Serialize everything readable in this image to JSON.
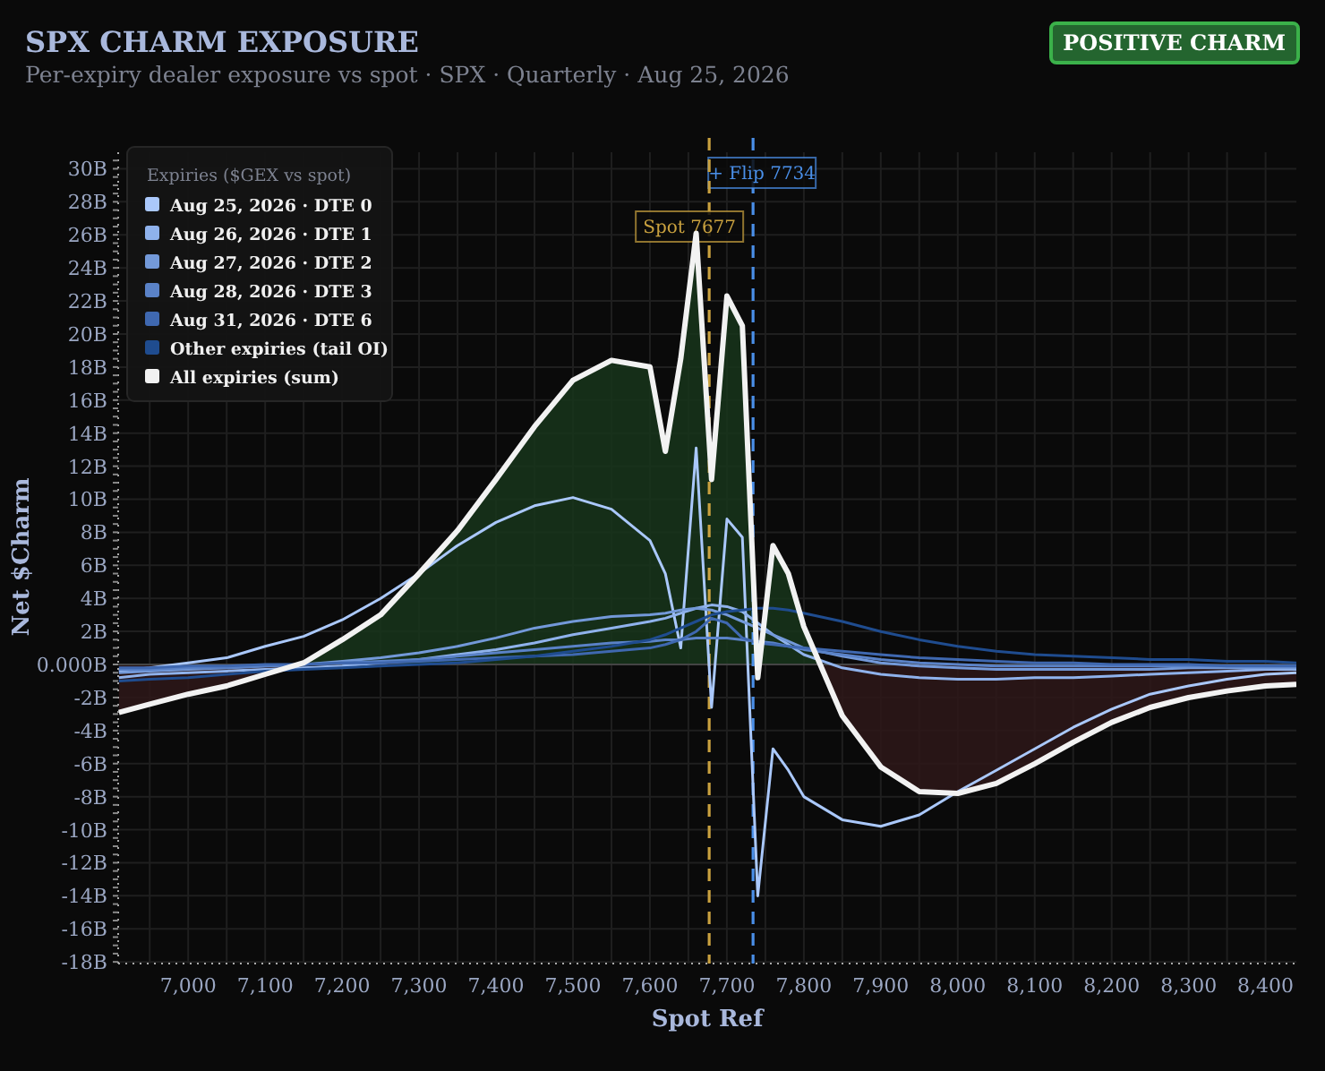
{
  "header": {
    "title": "SPX CHARM EXPOSURE",
    "subtitle": "Per-expiry dealer exposure vs spot · SPX · Quarterly · Aug 25, 2026",
    "badge": {
      "text": "POSITIVE CHARM"
    }
  },
  "chart": {
    "chart_data": {
      "type": "line",
      "xlabel": "Spot Ref",
      "ylabel": "Net $Charm",
      "grid": true,
      "legend": {
        "title": "Expiries ($GEX vs spot)"
      },
      "x": [
        6910,
        6950,
        7000,
        7050,
        7100,
        7150,
        7200,
        7250,
        7300,
        7350,
        7400,
        7450,
        7500,
        7550,
        7600,
        7620,
        7640,
        7660,
        7680,
        7700,
        7720,
        7740,
        7760,
        7780,
        7800,
        7850,
        7900,
        7950,
        8000,
        8050,
        8100,
        8150,
        8200,
        8250,
        8300,
        8350,
        8400,
        8440
      ],
      "series": [
        {
          "name": "Aug 25, 2026 · DTE 0",
          "color": "#aac8fb",
          "values": [
            -0.4,
            -0.2,
            0.1,
            0.4,
            1.1,
            1.7,
            2.7,
            4.0,
            5.5,
            7.2,
            8.6,
            9.6,
            10.1,
            9.4,
            7.5,
            5.5,
            1.0,
            13.1,
            -2.6,
            8.8,
            7.7,
            -14.0,
            -5.1,
            -6.4,
            -8.0,
            -9.4,
            -9.8,
            -9.1,
            -7.7,
            -6.4,
            -5.1,
            -3.8,
            -2.7,
            -1.8,
            -1.3,
            -0.9,
            -0.6,
            -0.5
          ]
        },
        {
          "name": "Aug 26, 2026 · DTE 1",
          "color": "#8fb2ec",
          "values": [
            -0.8,
            -0.6,
            -0.5,
            -0.4,
            -0.3,
            -0.2,
            -0.1,
            0.1,
            0.3,
            0.6,
            0.9,
            1.3,
            1.8,
            2.2,
            2.6,
            2.8,
            3.1,
            3.4,
            3.6,
            3.5,
            3.2,
            2.5,
            1.8,
            1.2,
            0.6,
            -0.2,
            -0.6,
            -0.8,
            -0.9,
            -0.9,
            -0.8,
            -0.8,
            -0.7,
            -0.6,
            -0.5,
            -0.4,
            -0.3,
            -0.3
          ]
        },
        {
          "name": "Aug 27, 2026 · DTE 2",
          "color": "#7399d9",
          "values": [
            -0.5,
            -0.4,
            -0.3,
            -0.2,
            -0.1,
            0.0,
            0.2,
            0.4,
            0.7,
            1.1,
            1.6,
            2.2,
            2.6,
            2.9,
            3.0,
            3.1,
            3.3,
            3.4,
            3.3,
            3.0,
            2.6,
            2.2,
            1.8,
            1.4,
            1.0,
            0.5,
            0.1,
            -0.1,
            -0.2,
            -0.3,
            -0.3,
            -0.3,
            -0.3,
            -0.3,
            -0.2,
            -0.2,
            -0.2,
            -0.2
          ]
        },
        {
          "name": "Aug 28, 2026 · DTE 3",
          "color": "#5a82c7",
          "values": [
            -0.3,
            -0.3,
            -0.2,
            -0.2,
            -0.1,
            0.0,
            0.1,
            0.2,
            0.3,
            0.5,
            0.7,
            0.9,
            1.1,
            1.3,
            1.4,
            1.5,
            1.5,
            1.6,
            1.6,
            1.6,
            1.5,
            1.4,
            1.3,
            1.1,
            0.9,
            0.6,
            0.3,
            0.1,
            0.0,
            -0.1,
            -0.1,
            -0.1,
            -0.1,
            -0.1,
            -0.1,
            -0.1,
            -0.1,
            -0.1
          ]
        },
        {
          "name": "Aug 31, 2026 · DTE 6",
          "color": "#3f68b0",
          "values": [
            -0.2,
            -0.2,
            -0.1,
            -0.1,
            0.0,
            0.0,
            0.1,
            0.1,
            0.2,
            0.3,
            0.4,
            0.5,
            0.6,
            0.8,
            1.0,
            1.2,
            1.5,
            2.0,
            2.8,
            2.5,
            1.6,
            1.3,
            1.2,
            1.1,
            1.0,
            0.8,
            0.6,
            0.4,
            0.3,
            0.2,
            0.1,
            0.1,
            0.0,
            0.0,
            0.0,
            -0.1,
            -0.1,
            -0.1
          ]
        },
        {
          "name": "Other expiries (tail OI)",
          "color": "#1f4c8f",
          "values": [
            -1.0,
            -0.9,
            -0.8,
            -0.6,
            -0.4,
            -0.3,
            -0.2,
            -0.1,
            0.0,
            0.1,
            0.3,
            0.5,
            0.8,
            1.1,
            1.5,
            1.8,
            2.2,
            2.6,
            3.0,
            3.2,
            3.3,
            3.4,
            3.4,
            3.3,
            3.1,
            2.6,
            2.0,
            1.5,
            1.1,
            0.8,
            0.6,
            0.5,
            0.4,
            0.3,
            0.3,
            0.2,
            0.2,
            0.1
          ]
        },
        {
          "name": "All expiries (sum)",
          "color": "#f2f2f2",
          "values": [
            -2.9,
            -2.4,
            -1.8,
            -1.3,
            -0.6,
            0.1,
            1.5,
            3.0,
            5.5,
            8.1,
            11.2,
            14.4,
            17.2,
            18.4,
            18.0,
            12.9,
            18.5,
            26.1,
            11.2,
            22.3,
            20.5,
            -0.8,
            7.2,
            5.5,
            2.3,
            -3.1,
            -6.2,
            -7.7,
            -7.8,
            -7.2,
            -6.0,
            -4.7,
            -3.5,
            -2.6,
            -2.0,
            -1.6,
            -1.3,
            -1.2
          ]
        }
      ],
      "xlim": [
        6909,
        8440
      ],
      "ylim": [
        -18.1,
        31
      ],
      "xticks": [
        {
          "value": 7000,
          "label": "7,000"
        },
        {
          "value": 7100,
          "label": "7,100"
        },
        {
          "value": 7200,
          "label": "7,200"
        },
        {
          "value": 7300,
          "label": "7,300"
        },
        {
          "value": 7400,
          "label": "7,400"
        },
        {
          "value": 7500,
          "label": "7,500"
        },
        {
          "value": 7600,
          "label": "7,600"
        },
        {
          "value": 7700,
          "label": "7,700"
        },
        {
          "value": 7800,
          "label": "7,800"
        },
        {
          "value": 7900,
          "label": "7,900"
        },
        {
          "value": 8000,
          "label": "8,000"
        },
        {
          "value": 8100,
          "label": "8,100"
        },
        {
          "value": 8200,
          "label": "8,200"
        },
        {
          "value": 8300,
          "label": "8,300"
        },
        {
          "value": 8400,
          "label": "8,400"
        }
      ],
      "yticks": [
        {
          "value": 30,
          "label": "30B"
        },
        {
          "value": 28,
          "label": "28B"
        },
        {
          "value": 26,
          "label": "26B"
        },
        {
          "value": 24,
          "label": "24B"
        },
        {
          "value": 22,
          "label": "22B"
        },
        {
          "value": 20,
          "label": "20B"
        },
        {
          "value": 18,
          "label": "18B"
        },
        {
          "value": 16,
          "label": "16B"
        },
        {
          "value": 14,
          "label": "14B"
        },
        {
          "value": 12,
          "label": "12B"
        },
        {
          "value": 10,
          "label": "10B"
        },
        {
          "value": 8,
          "label": "8B"
        },
        {
          "value": 6,
          "label": "6B"
        },
        {
          "value": 4,
          "label": "4B"
        },
        {
          "value": 2,
          "label": "2B"
        },
        {
          "value": 0,
          "label": "0.000B"
        },
        {
          "value": -2,
          "label": "-2B"
        },
        {
          "value": -4,
          "label": "-4B"
        },
        {
          "value": -6,
          "label": "-6B"
        },
        {
          "value": -8,
          "label": "-8B"
        },
        {
          "value": -10,
          "label": "-10B"
        },
        {
          "value": -12,
          "label": "-12B"
        },
        {
          "value": -14,
          "label": "-14B"
        },
        {
          "value": -16,
          "label": "-16B"
        },
        {
          "value": -18,
          "label": "-18B"
        }
      ],
      "ref_lines": [
        {
          "axis": "x",
          "value": 7734,
          "label": "+ Flip 7734",
          "color": "#4a8fe8"
        },
        {
          "axis": "x",
          "value": 7677,
          "label": "Spot 7677",
          "color": "#c9a13f"
        }
      ]
    }
  }
}
